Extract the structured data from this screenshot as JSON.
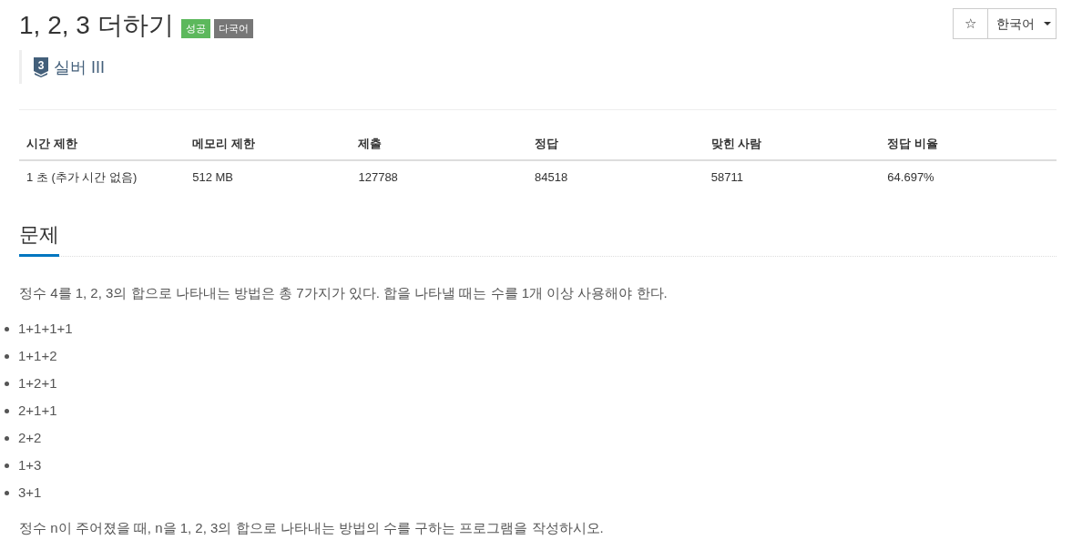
{
  "header": {
    "title": "1, 2, 3 더하기",
    "badges": [
      {
        "label": "성공",
        "color": "#5cb85c"
      },
      {
        "label": "다국어",
        "color": "#777777"
      }
    ],
    "tier": {
      "number": "3",
      "label": "실버 III"
    },
    "favorite_button": {
      "label": "☆"
    },
    "language_select": {
      "value": "한국어"
    }
  },
  "info_table": {
    "columns": [
      "시간 제한",
      "메모리 제한",
      "제출",
      "정답",
      "맞힌 사람",
      "정답 비율"
    ],
    "rows": [
      [
        "1 초 (추가 시간 없음)",
        "512 MB",
        "127788",
        "84518",
        "58711",
        "64.697%"
      ]
    ]
  },
  "problem": {
    "heading": "문제",
    "content": [
      {
        "kind": "paragraph",
        "text": "정수 4를 1, 2, 3의 합으로 나타내는 방법은 총 7가지가 있다. 합을 나타낼 때는 수를 1개 이상 사용해야 한다."
      },
      {
        "kind": "list",
        "items": [
          "1+1+1+1",
          "1+1+2",
          "1+2+1",
          "2+1+1",
          "2+2",
          "1+3",
          "3+1"
        ]
      },
      {
        "kind": "paragraph",
        "text": "정수 n이 주어졌을 때, n을 1, 2, 3의 합으로 나타내는 방법의 수를 구하는 프로그램을 작성하시오."
      }
    ]
  }
}
